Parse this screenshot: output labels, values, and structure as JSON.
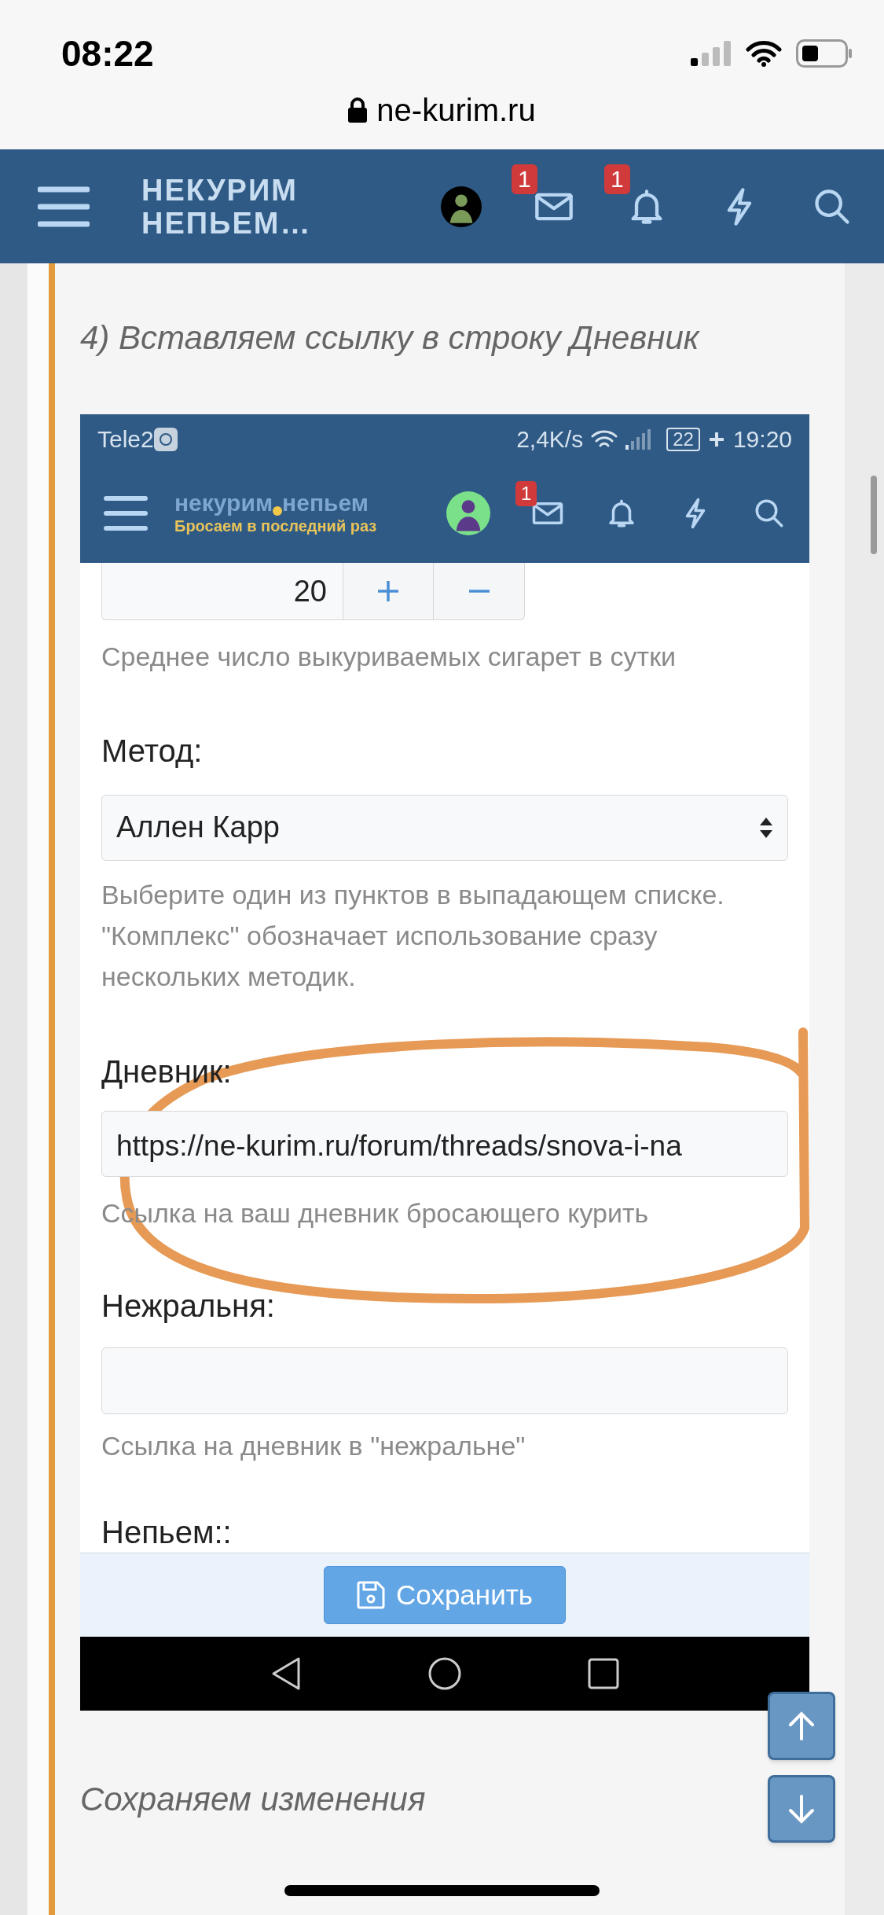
{
  "status_bar": {
    "time": "08:22"
  },
  "address_bar": {
    "url": "ne-kurim.ru"
  },
  "header": {
    "logo_lines": [
      "НЕКУРИМ",
      "НЕПЬЕМ…"
    ],
    "icons": [
      {
        "kind": "avatar"
      },
      {
        "kind": "mail",
        "badge": "1"
      },
      {
        "kind": "bell",
        "badge": "1"
      },
      {
        "kind": "bolt"
      },
      {
        "kind": "search"
      }
    ]
  },
  "post": {
    "heading": "4) Вставляем ссылку в строку Дневник",
    "embedded_screenshot": {
      "status_bar": {
        "carrier": "Tele2",
        "speed": "2,4K/s",
        "battery": "22",
        "time": "19:20"
      },
      "header": {
        "logo_parts": [
          "некурим",
          "непьем"
        ],
        "tagline": "Бросаем в последний раз",
        "icons": [
          {
            "kind": "avatar"
          },
          {
            "kind": "mail",
            "badge": "1"
          },
          {
            "kind": "bell"
          },
          {
            "kind": "bolt"
          },
          {
            "kind": "search"
          }
        ]
      },
      "form": [
        {
          "kind": "stepper",
          "value": "20",
          "hint": "Среднее число выкуриваемых сигарет в сутки"
        },
        {
          "kind": "select",
          "label": "Метод:",
          "value": "Аллен Карр",
          "hint": "Выберите один из пунктов в выпадающем списке. \"Комплекс\" обозначает использование сразу нескольких методик."
        },
        {
          "kind": "text",
          "label": "Дневник:",
          "value": "https://ne-kurim.ru/forum/threads/snova-i-na",
          "hint": "Ссылка на ваш дневник бросающего курить",
          "circled": true
        },
        {
          "kind": "text",
          "label": "Нежральня:",
          "hint": "Ссылка на дневник в \"нежральне\""
        },
        {
          "kind": "label",
          "label": "Непьем::"
        }
      ],
      "save_button": {
        "label": "Сохранить"
      }
    },
    "caption": "Сохраняем изменения"
  }
}
